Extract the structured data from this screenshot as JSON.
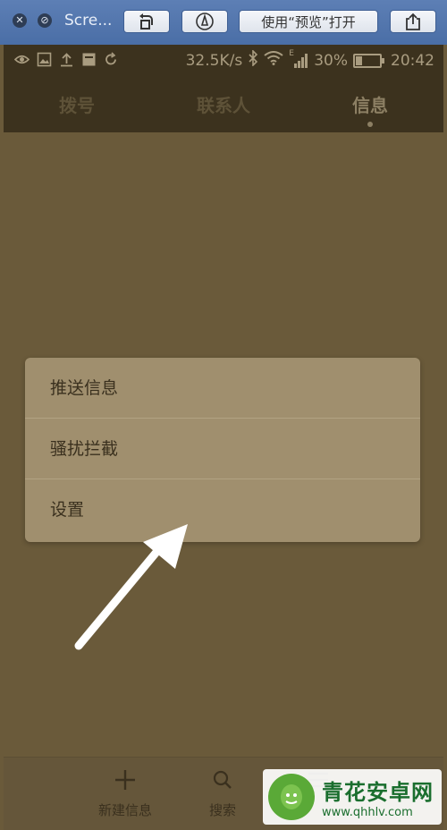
{
  "window": {
    "title": "Scre...",
    "open_with_button": "使用“预览”打开"
  },
  "status_bar": {
    "speed": "32.5K/s",
    "network_badge": "E",
    "battery": "30%",
    "time": "20:42"
  },
  "tabs": [
    {
      "label": "拨号",
      "active": false
    },
    {
      "label": "联系人",
      "active": false
    },
    {
      "label": "信息",
      "active": true
    }
  ],
  "menu": {
    "items": [
      "推送信息",
      "骚扰拦截",
      "设置"
    ]
  },
  "bottom_bar": {
    "items": [
      {
        "label": "新建信息",
        "icon": "plus-icon"
      },
      {
        "label": "搜索",
        "icon": "search-icon"
      },
      {
        "label": "",
        "icon": "menu-icon"
      }
    ]
  },
  "watermark": {
    "name": "青花安卓网",
    "url": "www.qhhlv.com"
  },
  "colors": {
    "overlay_bg": "#6a5a3a",
    "menu_bg": "#a08f6e",
    "mac_toolbar": "#4a6ea6",
    "arrow": "#ffffff"
  }
}
